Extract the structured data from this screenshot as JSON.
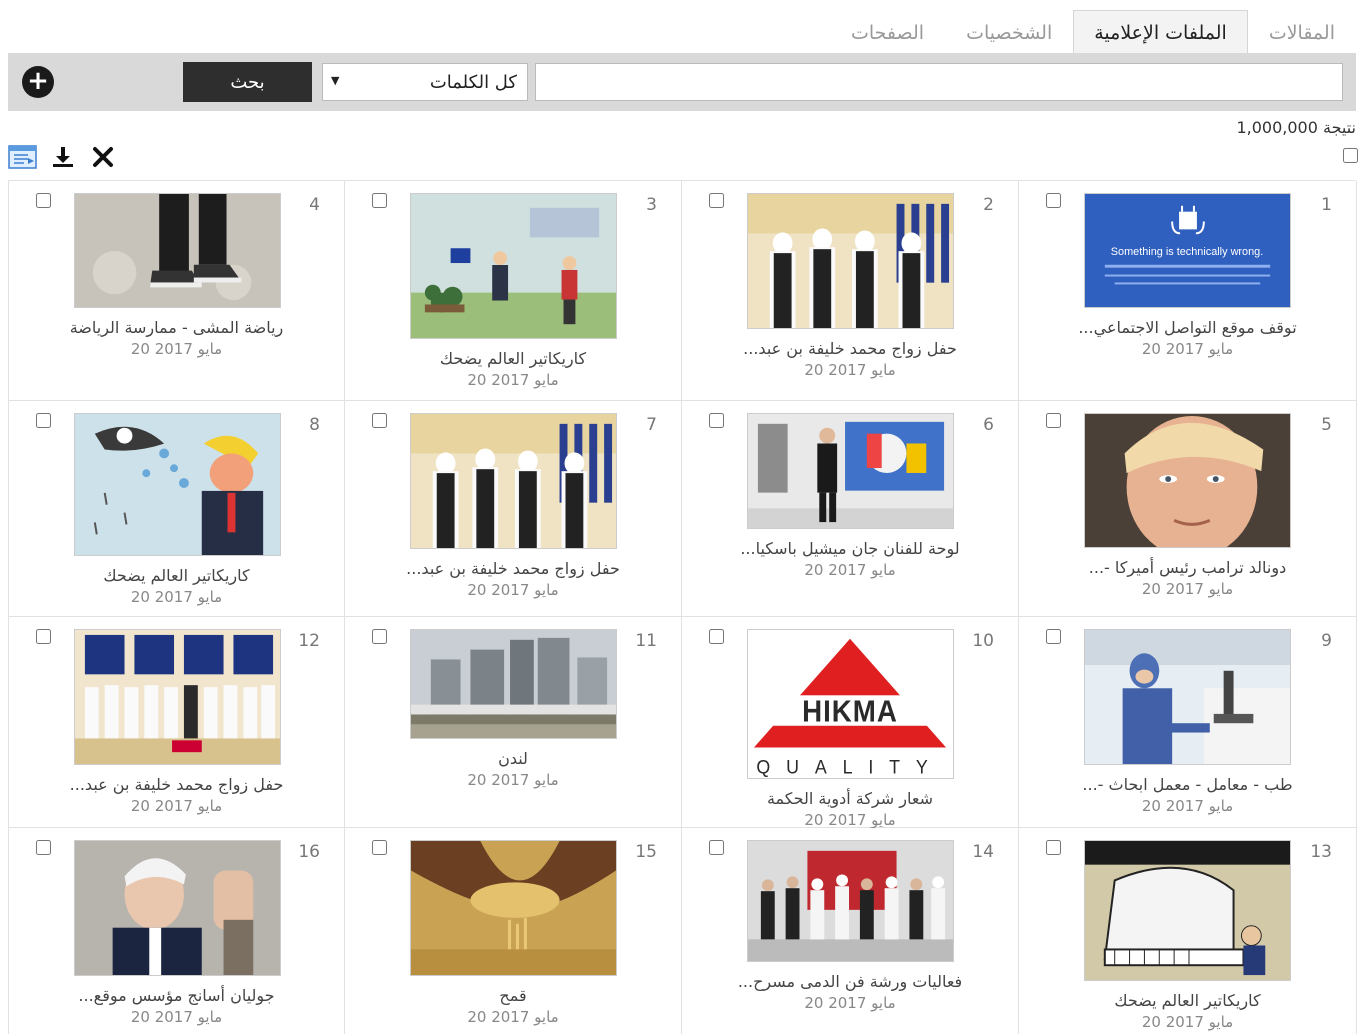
{
  "tabs": [
    {
      "label": "المقالات",
      "active": false
    },
    {
      "label": "الملفات الإعلامية",
      "active": true
    },
    {
      "label": "الشخصيات",
      "active": false
    },
    {
      "label": "الصفحات",
      "active": false
    }
  ],
  "search": {
    "query": "",
    "scope": "كل الكلمات",
    "button": "بحث"
  },
  "results": {
    "count_text": "1,000,000 نتيجة"
  },
  "toolbar": {
    "icons": [
      "close-icon",
      "download-icon",
      "export-icon"
    ]
  },
  "items": [
    {
      "num": "1",
      "title": "توقف موقع التواصل الاجتماعي...",
      "date": "20 مايو 2017",
      "image": "error-page"
    },
    {
      "num": "2",
      "title": "حفل زواج محمد خليفة بن عبد...",
      "date": "20 مايو 2017",
      "image": "ceremony"
    },
    {
      "num": "3",
      "title": "كاريكاتير العالم يضحك",
      "date": "20 مايو 2017",
      "image": "cartoon-eu"
    },
    {
      "num": "4",
      "title": "رياضة المشى - ممارسة الرياضة",
      "date": "20 مايو 2017",
      "image": "walking"
    },
    {
      "num": "5",
      "title": "دونالد ترامب رئيس أميركا -...",
      "date": "20 مايو 2017",
      "image": "portrait"
    },
    {
      "num": "6",
      "title": "لوحة للفنان جان ميشيل باسكيا...",
      "date": "20 مايو 2017",
      "image": "gallery"
    },
    {
      "num": "7",
      "title": "حفل زواج محمد خليفة بن عبد...",
      "date": "20 مايو 2017",
      "image": "ceremony"
    },
    {
      "num": "8",
      "title": "كاريكاتير العالم يضحك",
      "date": "20 مايو 2017",
      "image": "cartoon-eagle"
    },
    {
      "num": "9",
      "title": "طب - معامل - معمل ابحاث -...",
      "date": "20 مايو 2017",
      "image": "lab"
    },
    {
      "num": "10",
      "title": "شعار شركة أدوية الحكمة",
      "date": "20 مايو 2017",
      "image": "hikma-logo",
      "logo_text": "HIKMA",
      "logo_sub": "QUALITY"
    },
    {
      "num": "11",
      "title": "لندن",
      "date": "20 مايو 2017",
      "image": "city"
    },
    {
      "num": "12",
      "title": "حفل زواج محمد خليفة بن عبد...",
      "date": "20 مايو 2017",
      "image": "group-hall"
    },
    {
      "num": "13",
      "title": "كاريكاتير العالم يضحك",
      "date": "20 مايو 2017",
      "image": "cartoon-piano"
    },
    {
      "num": "14",
      "title": "فعاليات ورشة فن الدمى مسرح...",
      "date": "20 مايو 2017",
      "image": "group-photo"
    },
    {
      "num": "15",
      "title": "قمح",
      "date": "20 مايو 2017",
      "image": "grain"
    },
    {
      "num": "16",
      "title": "جوليان أسانج مؤسس موقع...",
      "date": "20 مايو 2017",
      "image": "man-wave"
    }
  ],
  "colors": {
    "active_tab_bg": "#f3f3f3",
    "search_bar_bg": "#d9d9d9",
    "button_bg": "#2e2e2e",
    "hikma_red": "#e02020"
  }
}
